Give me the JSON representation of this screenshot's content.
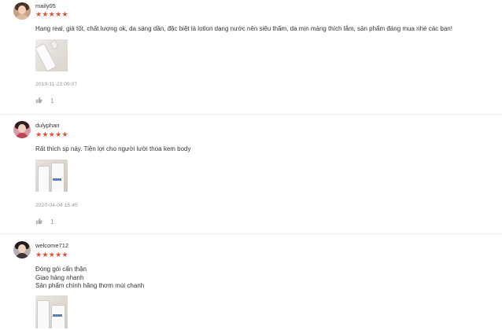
{
  "reviews": [
    {
      "username": "maily05",
      "rating": 5,
      "stars": "★★★★★",
      "text": "Hang real, giá tốt, chất lượng ok, da sáng dần, đặc biệt là lotion dạng nước nên siêu thấm, da mịn màng thích lắm, sản phẩm đáng mua nhé các bạn!",
      "date": "2019-11-23 09:07",
      "likes": "1"
    },
    {
      "username": "dulyphan",
      "rating": 5,
      "stars": "★★★★★",
      "text": "Rất thích sp này. Tiện lợi cho người lười thoa kem body",
      "date": "2020-04-04 15:45",
      "likes": "1"
    },
    {
      "username": "welcome712",
      "rating": 5,
      "stars": "★★★★★",
      "text": "Đóng gói cẩn thận\nGiao hàng nhanh\nSản phẩm chính hãng thơm mùi chanh"
    }
  ],
  "colors": {
    "star": "#ee4d2d",
    "meta": "#999999",
    "divider": "#ececec"
  },
  "icons": {
    "like": "thumbs-up-icon",
    "star": "star-icon"
  }
}
